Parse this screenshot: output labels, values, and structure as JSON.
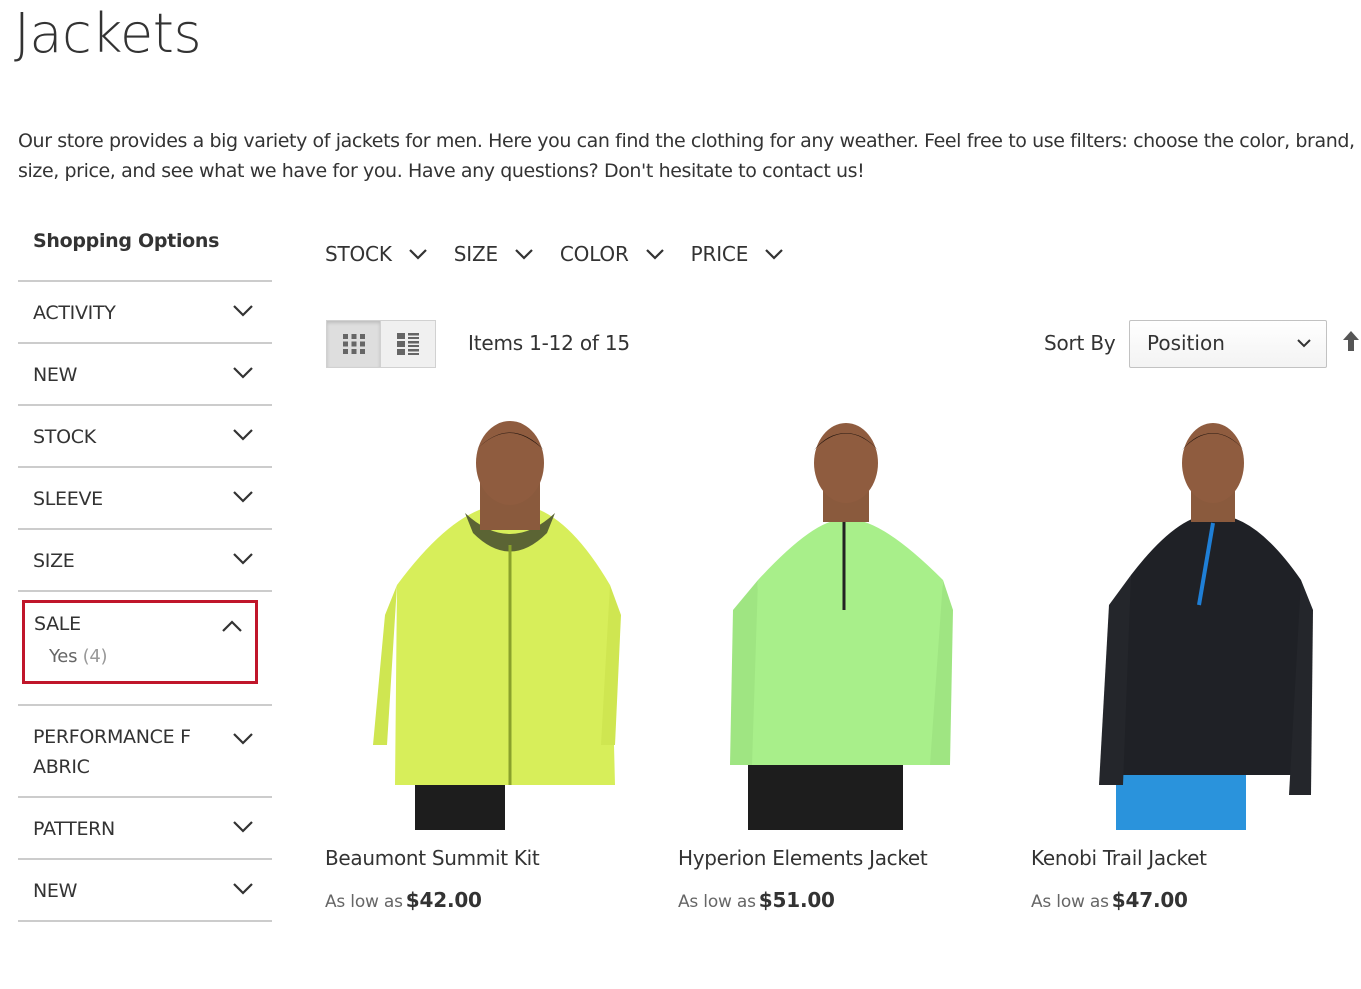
{
  "page": {
    "title": "Jackets",
    "description": "Our store provides a big variety of jackets for men. Here you can find the clothing for any weather. Feel free to use filters: choose the color, brand, size, price, and see what we have for you. Have any questions? Don't hesitate to contact us!"
  },
  "sidebar": {
    "title": "Shopping Options",
    "filters": [
      {
        "label": "ACTIVITY"
      },
      {
        "label": "NEW"
      },
      {
        "label": "STOCK"
      },
      {
        "label": "SLEEVE"
      },
      {
        "label": "SIZE"
      },
      {
        "label": "SALE",
        "expanded": true,
        "option_label": "Yes",
        "option_count": "(4)"
      },
      {
        "label": "PERFORMANCE F ABRIC"
      },
      {
        "label": "PATTERN"
      },
      {
        "label": "NEW"
      }
    ],
    "highlight_color": "#c0162a"
  },
  "top_filters": [
    {
      "label": "STOCK"
    },
    {
      "label": "SIZE"
    },
    {
      "label": "COLOR"
    },
    {
      "label": "PRICE"
    }
  ],
  "toolbar": {
    "view_modes": [
      "grid-icon",
      "list-icon"
    ],
    "active_mode": "grid",
    "amount": "Items 1-12 of 15",
    "sort_label": "Sort By",
    "sort_value": "Position",
    "sort_direction_icon": "arrow-up-icon"
  },
  "products": [
    {
      "name": "Beaumont Summit Kit",
      "price_prefix": "As low as",
      "price": "$42.00",
      "jacket_color": "#d7ee5a",
      "zip_color": "#8aa12c"
    },
    {
      "name": "Hyperion Elements Jacket",
      "price_prefix": "As low as",
      "price": "$51.00",
      "jacket_color": "#a8ef8a",
      "zip_color": "#222222"
    },
    {
      "name": "Kenobi Trail Jacket",
      "price_prefix": "As low as",
      "price": "$47.00",
      "jacket_color": "#1f2126",
      "zip_color": "#1f7fd6"
    }
  ]
}
